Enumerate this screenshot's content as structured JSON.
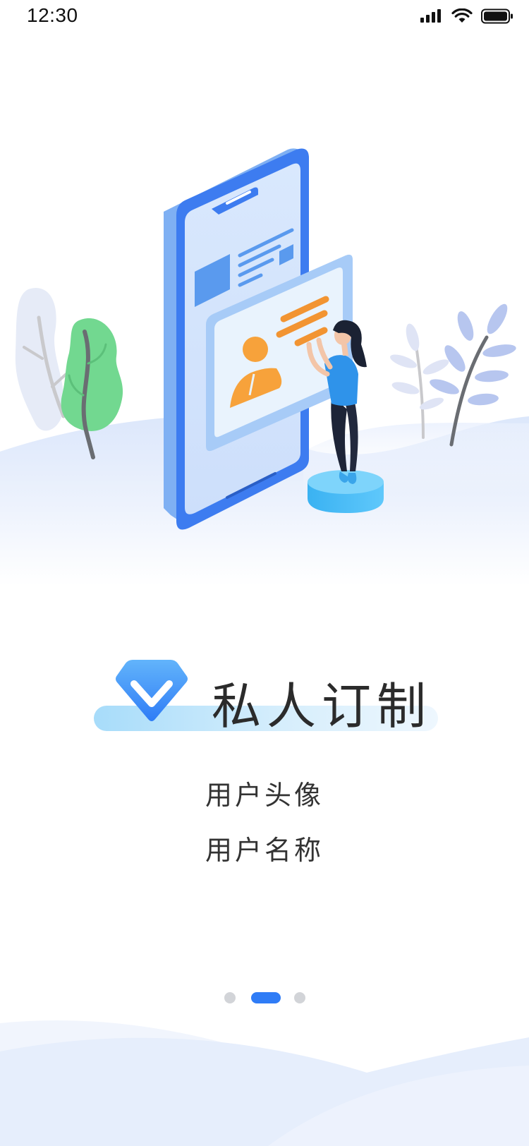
{
  "status_bar": {
    "time": "12:30",
    "icons": [
      "signal-icon",
      "wifi-icon",
      "battery-icon"
    ]
  },
  "illustration": {
    "name": "phone-id-card-illustration",
    "subjects": [
      "phone",
      "id-card",
      "woman",
      "plants"
    ]
  },
  "onboarding": {
    "title": "私人订制",
    "items": [
      "用户头像",
      "用户名称"
    ]
  },
  "pager": {
    "total": 3,
    "active_index": 1
  },
  "colors": {
    "accent": "#2f7cf6",
    "phone_blue": "#3d7cf0",
    "card_orange": "#f7a23b",
    "plant_green": "#6fd68e",
    "title_text": "#2b2b2b"
  }
}
